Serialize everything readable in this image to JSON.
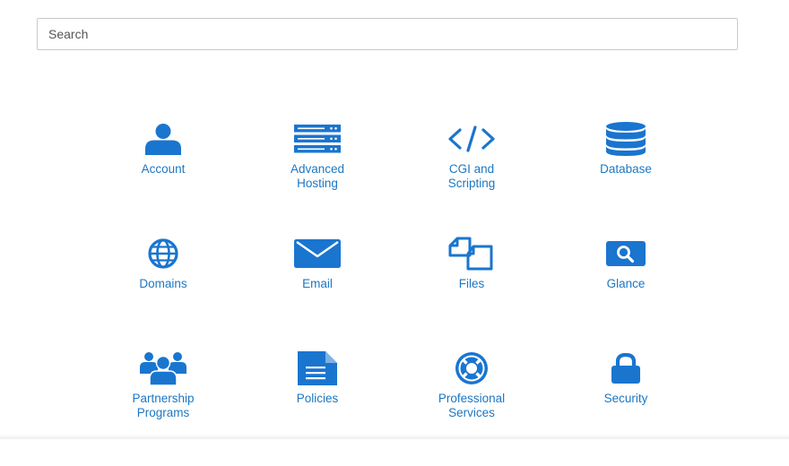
{
  "search": {
    "placeholder": "Search",
    "value": ""
  },
  "colors": {
    "accent": "#1c77c3",
    "icon": "#1a75cf"
  },
  "tiles": [
    {
      "label": "Account",
      "icon": "user-icon"
    },
    {
      "label": "Advanced\nHosting",
      "icon": "server-icon"
    },
    {
      "label": "CGI and\nScripting",
      "icon": "code-icon"
    },
    {
      "label": "Database",
      "icon": "database-icon"
    },
    {
      "label": "Domains",
      "icon": "globe-icon"
    },
    {
      "label": "Email",
      "icon": "envelope-icon"
    },
    {
      "label": "Files",
      "icon": "files-icon"
    },
    {
      "label": "Glance",
      "icon": "glance-icon"
    },
    {
      "label": "Partnership\nPrograms",
      "icon": "users-icon"
    },
    {
      "label": "Policies",
      "icon": "document-icon"
    },
    {
      "label": "Professional\nServices",
      "icon": "lifebuoy-icon"
    },
    {
      "label": "Security",
      "icon": "lock-icon"
    }
  ]
}
